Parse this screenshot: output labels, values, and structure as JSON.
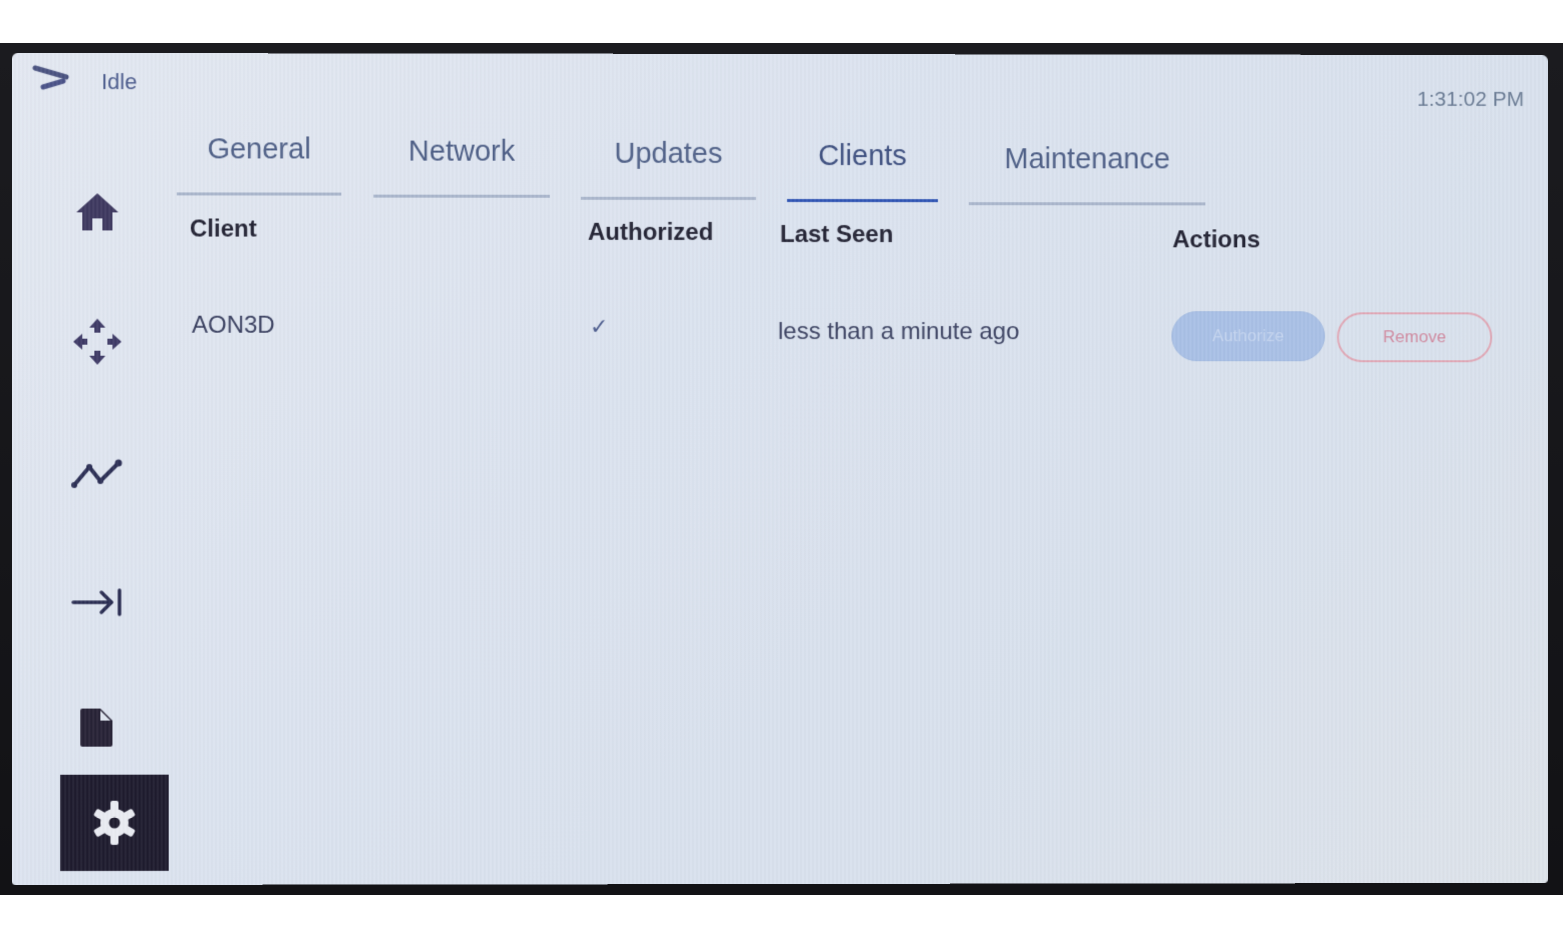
{
  "status_bar": {
    "logo_icon": "logo-chevron-icon",
    "status": "Idle",
    "clock": "1:31:02 PM"
  },
  "sidebar": {
    "items": [
      {
        "name": "home",
        "icon": "home-icon",
        "active": false
      },
      {
        "name": "move",
        "icon": "move-arrows-icon",
        "active": false
      },
      {
        "name": "graph",
        "icon": "line-chart-icon",
        "active": false
      },
      {
        "name": "extrude",
        "icon": "arrow-to-bar-icon",
        "active": false
      },
      {
        "name": "files",
        "icon": "file-icon",
        "active": false
      },
      {
        "name": "settings",
        "icon": "gear-icon",
        "active": true
      }
    ]
  },
  "tabs": [
    {
      "label": "General",
      "active": false
    },
    {
      "label": "Network",
      "active": false
    },
    {
      "label": "Updates",
      "active": false
    },
    {
      "label": "Clients",
      "active": true
    },
    {
      "label": "Maintenance",
      "active": false
    }
  ],
  "clients_table": {
    "headers": {
      "client": "Client",
      "authorized": "Authorized",
      "last_seen": "Last Seen",
      "actions": "Actions"
    },
    "rows": [
      {
        "client": "AON3D",
        "authorized": "✓",
        "last_seen": "less than a minute ago",
        "actions": {
          "authorize": "Authorize",
          "remove": "Remove"
        }
      }
    ]
  },
  "colors": {
    "accent": "#2f54b4",
    "active_nav_bg": "#1e1b2e",
    "authorize_button": "#a9c0e6",
    "remove_button": "#e0a8b6"
  }
}
